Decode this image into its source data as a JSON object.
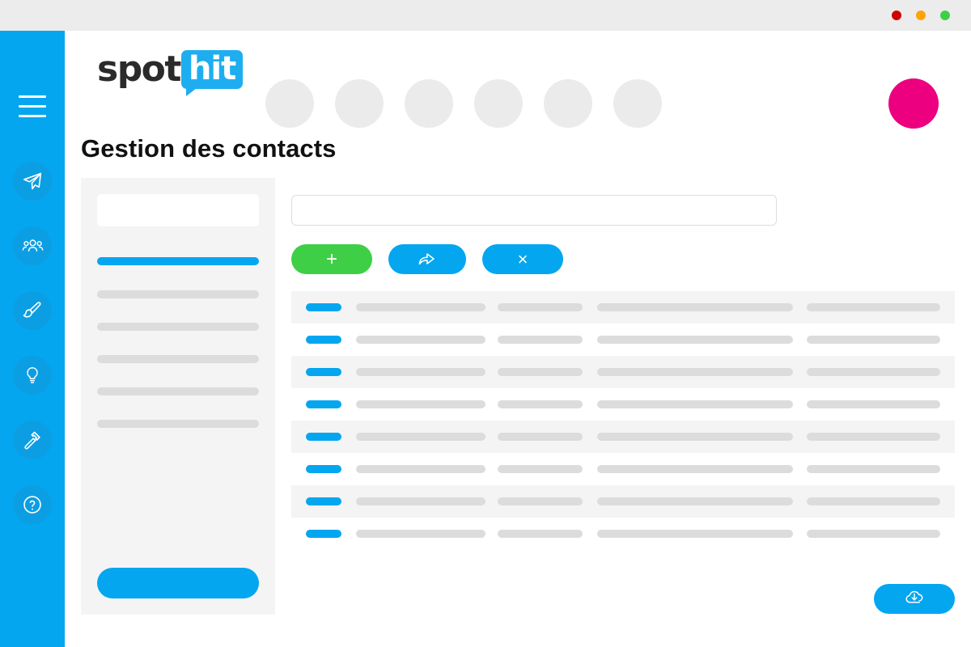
{
  "window": {
    "traffic_lights": [
      {
        "name": "close-button",
        "color": "#d00000"
      },
      {
        "name": "minimize-button",
        "color": "#ffa400"
      },
      {
        "name": "maximize-button",
        "color": "#3ecf47"
      }
    ]
  },
  "brand": {
    "logo_part_1": "spot",
    "logo_part_2": "hit",
    "bubble_color": "#1eaef0",
    "accent_color": "#04a6f0",
    "avatar_color": "#ec0080"
  },
  "rail": {
    "menu_icon": "hamburger-icon",
    "items": [
      {
        "icon": "paper-plane-icon",
        "label": "Campagnes"
      },
      {
        "icon": "users-icon",
        "label": "Contacts"
      },
      {
        "icon": "paint-brush-icon",
        "label": "Modeles"
      },
      {
        "icon": "lightbulb-icon",
        "label": "Idees"
      },
      {
        "icon": "hammer-icon",
        "label": "Outils"
      },
      {
        "icon": "help-icon",
        "label": "Aide"
      }
    ]
  },
  "header": {
    "skeleton_nav_count": 6,
    "avatar_name": "user-avatar"
  },
  "main": {
    "page_title": "Gestion des contacts",
    "search": {
      "value": "",
      "placeholder": ""
    },
    "actions": [
      {
        "name": "add-contact-button",
        "icon": "plus-icon",
        "label": "+",
        "color": "#3ecf47"
      },
      {
        "name": "share-contact-button",
        "icon": "share-icon",
        "label": "",
        "color": "#04a6f0"
      },
      {
        "name": "delete-contact-button",
        "icon": "close-icon",
        "label": "×",
        "color": "#04a6f0"
      }
    ],
    "download_button": {
      "name": "download-button",
      "icon": "cloud-download-icon",
      "label": ""
    }
  },
  "side_panel": {
    "search_placeholder": "",
    "items": [
      {
        "state": "active",
        "label": ""
      },
      {
        "state": "loading",
        "label": ""
      },
      {
        "state": "loading",
        "label": ""
      },
      {
        "state": "loading",
        "label": ""
      },
      {
        "state": "loading",
        "label": ""
      },
      {
        "state": "loading",
        "label": ""
      }
    ],
    "cta_label": ""
  },
  "table": {
    "row_count": 8,
    "rows": [
      {
        "status": "loading",
        "cells": [
          "",
          "",
          "",
          ""
        ]
      },
      {
        "status": "loading",
        "cells": [
          "",
          "",
          "",
          ""
        ]
      },
      {
        "status": "loading",
        "cells": [
          "",
          "",
          "",
          ""
        ]
      },
      {
        "status": "loading",
        "cells": [
          "",
          "",
          "",
          ""
        ]
      },
      {
        "status": "loading",
        "cells": [
          "",
          "",
          "",
          ""
        ]
      },
      {
        "status": "loading",
        "cells": [
          "",
          "",
          "",
          ""
        ]
      },
      {
        "status": "loading",
        "cells": [
          "",
          "",
          "",
          ""
        ]
      },
      {
        "status": "loading",
        "cells": [
          "",
          "",
          "",
          ""
        ]
      }
    ]
  }
}
